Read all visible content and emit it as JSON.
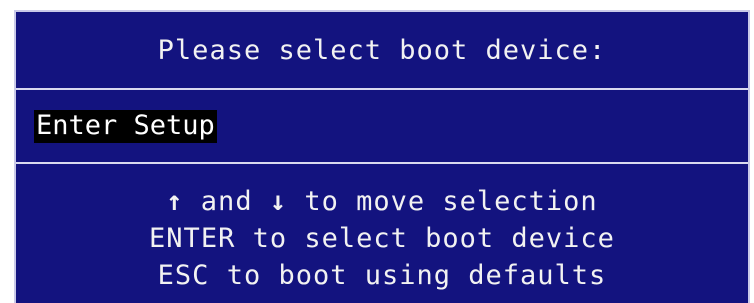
{
  "header": {
    "title": "Please select boot device:"
  },
  "menu": {
    "items": [
      {
        "label": "Enter Setup",
        "selected": true
      }
    ]
  },
  "help": {
    "arrow_up": "↑",
    "and_text": " and ",
    "arrow_down": "↓",
    "move_text": " to move selection",
    "line2": "ENTER to select boot device",
    "line3": "ESC to boot using defaults"
  },
  "colors": {
    "background": "#13137f",
    "text": "#f2f2f2",
    "selection_background": "#000000",
    "divider": "#d9d9ef"
  }
}
